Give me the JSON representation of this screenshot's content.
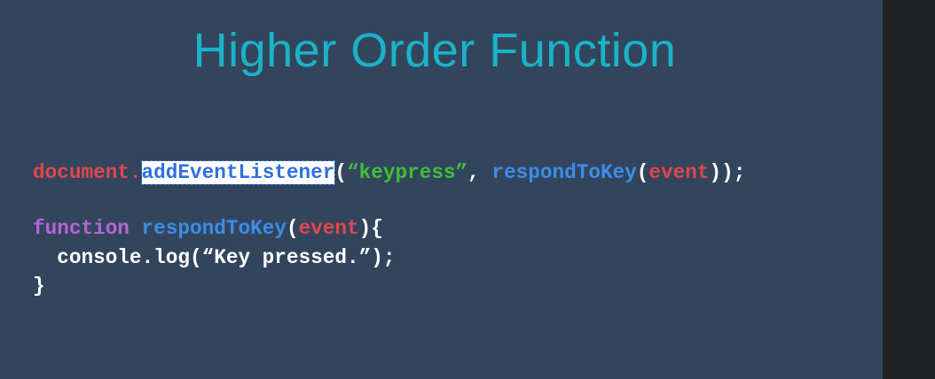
{
  "slide": {
    "title": "Higher Order Function"
  },
  "code": {
    "line1": {
      "obj": "document",
      "dot": ".",
      "method": "addEventListener",
      "open": "(",
      "arg_string": "“keypress”",
      "comma": ", ",
      "callback": "respondToKey",
      "open2": "(",
      "param": "event",
      "close": "));"
    },
    "line2": {
      "keyword": "function",
      "space": " ",
      "name": "respondToKey",
      "open": "(",
      "param": "event",
      "close": "){"
    },
    "line3": {
      "text": "  console.log(“Key pressed.”);"
    },
    "line4": {
      "text": "}"
    }
  },
  "colors": {
    "background": "#33455d",
    "title": "#1ab3c8",
    "identifier_red": "#e0474c",
    "string_green": "#3fbf3b",
    "function_blue": "#3a8ee8",
    "keyword_purple": "#b566d8",
    "selection_bg": "#ffffff"
  }
}
